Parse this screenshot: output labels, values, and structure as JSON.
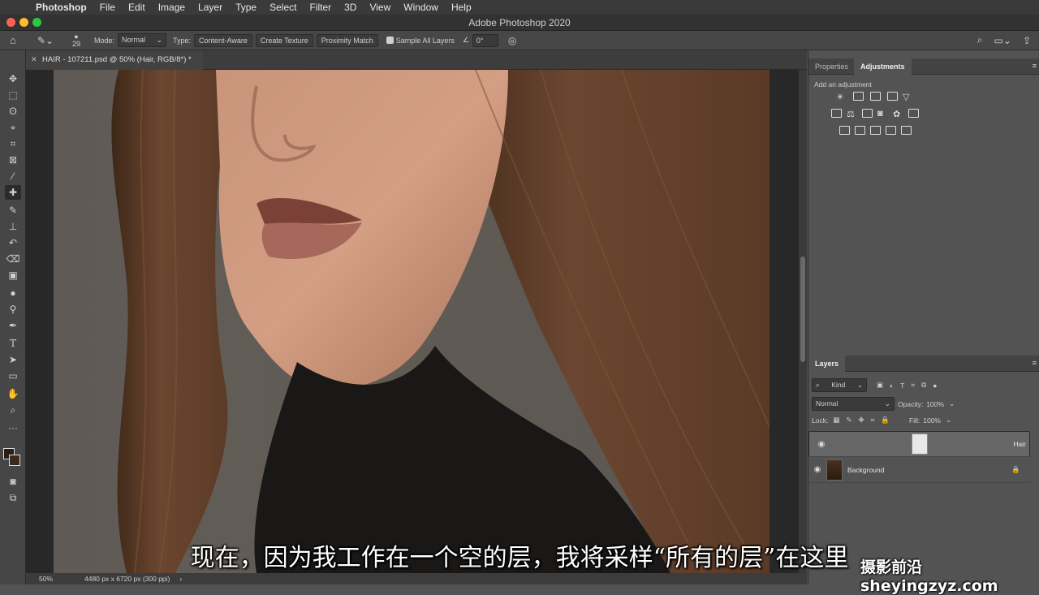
{
  "menubar": {
    "app_name": "Photoshop",
    "items": [
      "File",
      "Edit",
      "Image",
      "Layer",
      "Type",
      "Select",
      "Filter",
      "3D",
      "View",
      "Window",
      "Help"
    ]
  },
  "window": {
    "title": "Adobe Photoshop 2020"
  },
  "options": {
    "brush_size": "29",
    "mode_label": "Mode:",
    "mode_value": "Normal",
    "type_label": "Type:",
    "type_buttons": [
      "Content-Aware",
      "Create Texture",
      "Proximity Match"
    ],
    "sample_all_layers": "Sample All Layers",
    "angle_value": "0°"
  },
  "document": {
    "tab_title": "HAIR - 107211.psd @ 50% (Hair, RGB/8*) *",
    "zoom": "50%",
    "doc_info": "4480 px x 6720 px (300 ppi)"
  },
  "panels": {
    "top_tabs": [
      "Properties",
      "Adjustments"
    ],
    "active_top_tab": "Adjustments",
    "add_adjustment_label": "Add an adjustment",
    "layers_tab": "Layers",
    "kind_label": "Kind",
    "blend_mode": "Normal",
    "opacity_label": "Opacity:",
    "opacity_value": "100%",
    "lock_label": "Lock:",
    "fill_label": "Fill:",
    "fill_value": "100%",
    "layers": [
      {
        "name": "Hair",
        "selected": true
      },
      {
        "name": "Background",
        "locked": true
      }
    ]
  },
  "subtitle": "现在，因为我工作在一个空的层，我将采样“所有的层”在这里",
  "watermark": "摄影前沿 sheyingzyz.com",
  "colors": {
    "accent": "#535353",
    "menubar": "#3a3a3a",
    "close": "#ff5f57",
    "minimize": "#febc2e",
    "zoom": "#28c840"
  }
}
